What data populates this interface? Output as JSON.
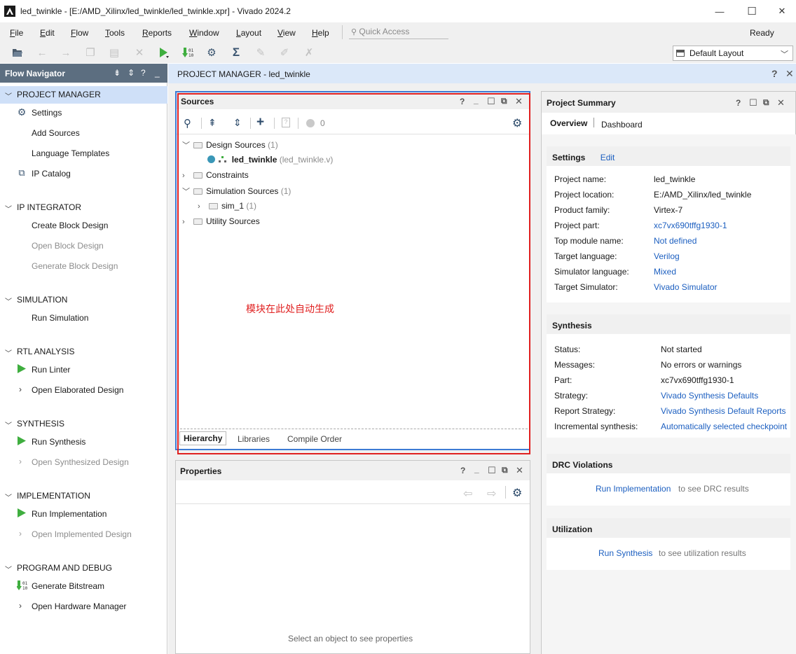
{
  "window": {
    "title": "led_twinkle - [E:/AMD_Xilinx/led_twinkle/led_twinkle.xpr] - Vivado 2024.2",
    "minimize": "—",
    "maximize": "☐",
    "close": "✕"
  },
  "menu": {
    "items": [
      "File",
      "Edit",
      "Flow",
      "Tools",
      "Reports",
      "Window",
      "Layout",
      "View",
      "Help"
    ],
    "quick_access_placeholder": "Quick Access",
    "status": "Ready"
  },
  "toolbar": {
    "layout_select": "Default Layout"
  },
  "flow_navigator": {
    "title": "Flow Navigator",
    "sections": {
      "project_manager": {
        "label": "PROJECT MANAGER",
        "items": [
          "Settings",
          "Add Sources",
          "Language Templates",
          "IP Catalog"
        ]
      },
      "ip_integrator": {
        "label": "IP INTEGRATOR",
        "items": [
          "Create Block Design",
          "Open Block Design",
          "Generate Block Design"
        ]
      },
      "simulation": {
        "label": "SIMULATION",
        "items": [
          "Run Simulation"
        ]
      },
      "rtl_analysis": {
        "label": "RTL ANALYSIS",
        "items": [
          "Run Linter",
          "Open Elaborated Design"
        ]
      },
      "synthesis": {
        "label": "SYNTHESIS",
        "items": [
          "Run Synthesis",
          "Open Synthesized Design"
        ]
      },
      "implementation": {
        "label": "IMPLEMENTATION",
        "items": [
          "Run Implementation",
          "Open Implemented Design"
        ]
      },
      "program_debug": {
        "label": "PROGRAM AND DEBUG",
        "items": [
          "Generate Bitstream",
          "Open Hardware Manager"
        ]
      }
    }
  },
  "main": {
    "header_prefix": "PROJECT MANAGER",
    "header_sep": " - ",
    "header_project": "led_twinkle",
    "help": "?",
    "close": "✕"
  },
  "sources": {
    "title": "Sources",
    "badge_count": "0",
    "tree": {
      "design_sources": "Design Sources",
      "design_sources_count": "(1)",
      "top_module": "led_twinkle",
      "top_module_file": "(led_twinkle.v)",
      "constraints": "Constraints",
      "sim_sources": "Simulation Sources",
      "sim_sources_count": "(1)",
      "sim_set": "sim_1",
      "sim_set_count": "(1)",
      "utility_sources": "Utility Sources"
    },
    "annotation": "模块在此处自动生成",
    "tabs": [
      "Hierarchy",
      "Libraries",
      "Compile Order"
    ]
  },
  "properties": {
    "title": "Properties",
    "empty_message": "Select an object to see properties"
  },
  "project_summary": {
    "title": "Project Summary",
    "tabs": [
      "Overview",
      "Dashboard"
    ],
    "settings": {
      "title": "Settings",
      "edit": "Edit",
      "rows": [
        {
          "label": "Project name:",
          "value": "led_twinkle",
          "link": false
        },
        {
          "label": "Project location:",
          "value": "E:/AMD_Xilinx/led_twinkle",
          "link": false
        },
        {
          "label": "Product family:",
          "value": "Virtex-7",
          "link": false
        },
        {
          "label": "Project part:",
          "value": "xc7vx690tffg1930-1",
          "link": true
        },
        {
          "label": "Top module name:",
          "value": "Not defined",
          "link": true
        },
        {
          "label": "Target language:",
          "value": "Verilog",
          "link": true
        },
        {
          "label": "Simulator language:",
          "value": "Mixed",
          "link": true
        },
        {
          "label": "Target Simulator:",
          "value": "Vivado Simulator",
          "link": true
        }
      ]
    },
    "synthesis": {
      "title": "Synthesis",
      "rows": [
        {
          "label": "Status:",
          "value": "Not started",
          "link": false
        },
        {
          "label": "Messages:",
          "value": "No errors or warnings",
          "link": false
        },
        {
          "label": "Part:",
          "value": "xc7vx690tffg1930-1",
          "link": false
        },
        {
          "label": "Strategy:",
          "value": "Vivado Synthesis Defaults",
          "link": true
        },
        {
          "label": "Report Strategy:",
          "value": "Vivado Synthesis Default Reports",
          "link": true
        },
        {
          "label": "Incremental synthesis:",
          "value": "Automatically selected checkpoint",
          "link": true
        }
      ]
    },
    "drc": {
      "title": "DRC Violations",
      "link": "Run Implementation",
      "text": "to see DRC results"
    },
    "utilization": {
      "title": "Utilization",
      "link": "Run Synthesis",
      "text": "to see utilization results"
    }
  },
  "colors": {
    "nav_header": "#5c6e80",
    "selection": "#cfe0f8",
    "link": "#1c5fc0",
    "annotation_red": "#e02020",
    "panel_blue": "#3d7bd4",
    "run_green": "#3fae3f"
  }
}
